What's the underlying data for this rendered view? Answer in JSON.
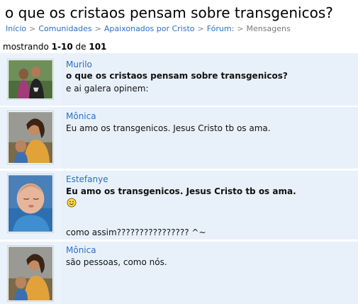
{
  "page": {
    "title": "o que os cristaos pensam sobre transgenicos?"
  },
  "breadcrumb": {
    "items": [
      "Início",
      "Comunidades",
      "Apaixonados por Cristo",
      "Fórum:"
    ],
    "current": "Mensagens",
    "separator": ">"
  },
  "pagination": {
    "prefix": "mostrando",
    "range": "1-10",
    "of": "de",
    "total": "101"
  },
  "posts": [
    {
      "author": "Murilo",
      "lines": [
        "o que os cristaos pensam sobre transgenicos?",
        "e ai galera opinem:"
      ],
      "avatar_icon": "couple-photo"
    },
    {
      "author": "Mônica",
      "lines": [
        "Eu amo os transgenicos. Jesus Cristo tb os ama."
      ],
      "avatar_icon": "woman-child-photo"
    },
    {
      "author": "Estefanye",
      "quote": "Eu amo os transgenicos. Jesus Cristo tb os ama.",
      "smiley_icon": "smiley-icon",
      "reply": "como assim???????????????? ^~",
      "avatar_icon": "baby-photo"
    },
    {
      "author": "Mônica",
      "lines": [
        "são pessoas, como nós."
      ],
      "avatar_icon": "woman-child-photo"
    }
  ],
  "colors": {
    "link": "#2a6fc2",
    "post_bg": "#e8f1fa",
    "muted": "#777777"
  }
}
